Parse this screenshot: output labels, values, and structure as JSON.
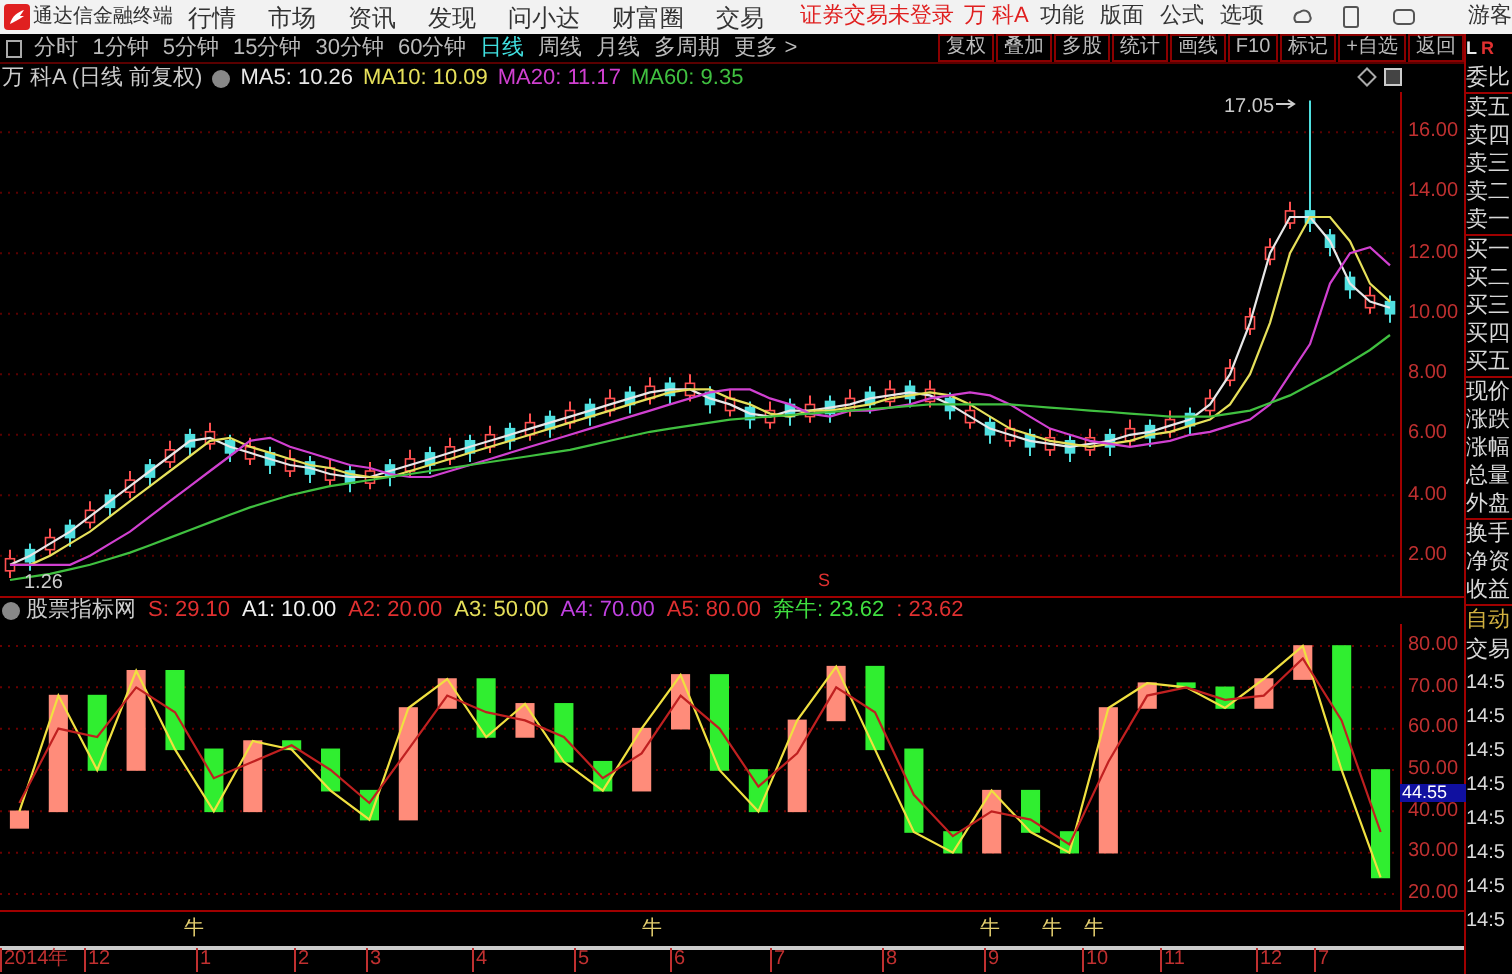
{
  "app_bar": {
    "title": "通达信金融终端",
    "menu": [
      "行情",
      "市场",
      "资讯",
      "发现",
      "问小达",
      "财富圈",
      "交易"
    ],
    "login_status": "证券交易未登录",
    "stock": "万 科A",
    "right_menu": [
      "功能",
      "版面",
      "公式",
      "选项"
    ],
    "user": "游客"
  },
  "period_tabs": [
    {
      "label": "分时",
      "selected": false
    },
    {
      "label": "1分钟",
      "selected": false
    },
    {
      "label": "5分钟",
      "selected": false
    },
    {
      "label": "15分钟",
      "selected": false
    },
    {
      "label": "30分钟",
      "selected": false
    },
    {
      "label": "60分钟",
      "selected": false
    },
    {
      "label": "日线",
      "selected": true
    },
    {
      "label": "周线",
      "selected": false
    },
    {
      "label": "月线",
      "selected": false
    },
    {
      "label": "多周期",
      "selected": false
    },
    {
      "label": "更多 >",
      "selected": false
    }
  ],
  "toolbar_buttons": [
    "复权",
    "叠加",
    "多股",
    "统计",
    "画线",
    "F10",
    "标记",
    "+自选",
    "返回"
  ],
  "main_chart": {
    "title": "万 科A (日线 前复权)",
    "ma": [
      {
        "label": "MA5: 10.26",
        "color": "#e8e8e8"
      },
      {
        "label": "MA10: 10.09",
        "color": "#e6e05a"
      },
      {
        "label": "MA20: 11.17",
        "color": "#d040d0"
      },
      {
        "label": "MA60: 9.35",
        "color": "#40c040"
      }
    ],
    "high_label": "17.05",
    "low_label": "1.26",
    "signal_mark": "S",
    "chart_data": {
      "type": "candlestick",
      "grid": true,
      "ylim": [
        0.8,
        17.2
      ],
      "yticks": [
        {
          "value": 16,
          "label": "16.00"
        },
        {
          "value": 14,
          "label": "14.00"
        },
        {
          "value": 12,
          "label": "12.00"
        },
        {
          "value": 10,
          "label": "10.00"
        },
        {
          "value": 8,
          "label": "8.00"
        },
        {
          "value": 6,
          "label": "6.00"
        },
        {
          "value": 4,
          "label": "4.00"
        },
        {
          "value": 2,
          "label": "2.00"
        }
      ],
      "ohlc": [
        [
          1.5,
          2.2,
          1.26,
          1.9
        ],
        [
          2.2,
          2.4,
          1.5,
          1.8
        ],
        [
          2.2,
          2.9,
          2.0,
          2.6
        ],
        [
          3.0,
          3.2,
          2.3,
          2.6
        ],
        [
          3.1,
          3.8,
          2.9,
          3.5
        ],
        [
          4.0,
          4.2,
          3.3,
          3.6
        ],
        [
          4.1,
          4.8,
          3.9,
          4.5
        ],
        [
          5.0,
          5.2,
          4.3,
          4.6
        ],
        [
          5.1,
          5.8,
          4.9,
          5.5
        ],
        [
          6.0,
          6.2,
          5.3,
          5.6
        ],
        [
          5.7,
          6.4,
          5.5,
          6.1
        ],
        [
          5.8,
          6.0,
          5.1,
          5.4
        ],
        [
          5.2,
          5.9,
          5.0,
          5.6
        ],
        [
          5.4,
          5.6,
          4.7,
          5.0
        ],
        [
          4.8,
          5.5,
          4.6,
          5.2
        ],
        [
          5.1,
          5.3,
          4.4,
          4.7
        ],
        [
          4.5,
          5.2,
          4.3,
          4.9
        ],
        [
          4.8,
          5.0,
          4.1,
          4.4
        ],
        [
          4.4,
          5.1,
          4.2,
          4.8
        ],
        [
          5.0,
          5.2,
          4.3,
          4.6
        ],
        [
          4.8,
          5.5,
          4.6,
          5.2
        ],
        [
          5.4,
          5.6,
          4.7,
          5.0
        ],
        [
          5.2,
          5.9,
          5.0,
          5.6
        ],
        [
          5.8,
          6.0,
          5.1,
          5.4
        ],
        [
          5.6,
          6.3,
          5.4,
          6.0
        ],
        [
          6.2,
          6.4,
          5.5,
          5.8
        ],
        [
          6.0,
          6.7,
          5.8,
          6.4
        ],
        [
          6.6,
          6.8,
          5.9,
          6.2
        ],
        [
          6.4,
          7.1,
          6.2,
          6.8
        ],
        [
          7.0,
          7.2,
          6.3,
          6.6
        ],
        [
          6.8,
          7.5,
          6.6,
          7.2
        ],
        [
          7.4,
          7.6,
          6.7,
          7.0
        ],
        [
          7.2,
          7.9,
          7.0,
          7.6
        ],
        [
          7.7,
          7.9,
          7.0,
          7.3
        ],
        [
          7.3,
          8.0,
          7.1,
          7.7
        ],
        [
          7.4,
          7.6,
          6.7,
          7.0
        ],
        [
          6.8,
          7.5,
          6.6,
          7.2
        ],
        [
          6.9,
          7.1,
          6.2,
          6.5
        ],
        [
          6.4,
          7.1,
          6.2,
          6.8
        ],
        [
          7.0,
          7.2,
          6.3,
          6.6
        ],
        [
          6.6,
          7.3,
          6.4,
          7.0
        ],
        [
          7.1,
          7.3,
          6.4,
          6.7
        ],
        [
          6.8,
          7.5,
          6.6,
          7.2
        ],
        [
          7.4,
          7.6,
          6.7,
          7.0
        ],
        [
          7.1,
          7.8,
          6.9,
          7.5
        ],
        [
          7.6,
          7.8,
          6.9,
          7.2
        ],
        [
          7.1,
          7.8,
          6.9,
          7.5
        ],
        [
          7.2,
          7.4,
          6.5,
          6.8
        ],
        [
          6.4,
          7.1,
          6.2,
          6.8
        ],
        [
          6.4,
          6.6,
          5.7,
          6.0
        ],
        [
          5.8,
          6.5,
          5.6,
          6.2
        ],
        [
          6.0,
          6.2,
          5.3,
          5.6
        ],
        [
          5.5,
          6.2,
          5.3,
          5.9
        ],
        [
          5.8,
          6.0,
          5.1,
          5.4
        ],
        [
          5.5,
          6.2,
          5.3,
          5.9
        ],
        [
          6.0,
          6.2,
          5.3,
          5.6
        ],
        [
          5.8,
          6.5,
          5.6,
          6.2
        ],
        [
          6.3,
          6.5,
          5.6,
          5.9
        ],
        [
          6.1,
          6.8,
          5.9,
          6.5
        ],
        [
          6.7,
          6.9,
          6.0,
          6.3
        ],
        [
          6.8,
          7.5,
          6.6,
          7.2
        ],
        [
          7.8,
          8.5,
          7.6,
          8.2
        ],
        [
          9.5,
          10.2,
          9.3,
          9.9
        ],
        [
          11.8,
          12.5,
          11.6,
          12.2
        ],
        [
          13.0,
          13.7,
          12.8,
          13.4
        ],
        [
          13.4,
          17.05,
          12.7,
          13.0
        ],
        [
          12.6,
          12.8,
          11.9,
          12.2
        ],
        [
          11.2,
          11.4,
          10.5,
          10.8
        ],
        [
          10.2,
          10.9,
          10.0,
          10.6
        ],
        [
          10.4,
          10.6,
          9.7,
          10.0
        ]
      ],
      "series": [
        {
          "type": "line",
          "color": "#e8e8e8",
          "values": [
            1.7,
            2.0,
            2.4,
            2.8,
            3.3,
            3.8,
            4.3,
            4.8,
            5.3,
            5.8,
            5.9,
            5.6,
            5.4,
            5.2,
            5.0,
            4.9,
            4.7,
            4.6,
            4.6,
            4.8,
            5.0,
            5.2,
            5.4,
            5.6,
            5.8,
            6.0,
            6.2,
            6.4,
            6.6,
            6.8,
            7.0,
            7.2,
            7.4,
            7.5,
            7.5,
            7.2,
            7.0,
            6.7,
            6.6,
            6.8,
            6.8,
            6.9,
            7.0,
            7.2,
            7.3,
            7.4,
            7.3,
            7.0,
            6.6,
            6.2,
            6.0,
            5.8,
            5.7,
            5.6,
            5.7,
            5.8,
            6.0,
            6.1,
            6.3,
            6.5,
            7.0,
            8.0,
            9.7,
            12.0,
            13.2,
            13.2,
            12.4,
            11.0,
            10.4,
            10.2
          ]
        },
        {
          "type": "line",
          "color": "#e6e05a",
          "values": [
            1.7,
            1.7,
            2.0,
            2.4,
            2.8,
            3.3,
            3.8,
            4.3,
            4.8,
            5.3,
            5.8,
            5.9,
            5.6,
            5.4,
            5.2,
            5.0,
            4.9,
            4.7,
            4.6,
            4.6,
            4.8,
            5.0,
            5.2,
            5.4,
            5.6,
            5.8,
            6.0,
            6.2,
            6.4,
            6.6,
            6.8,
            7.0,
            7.2,
            7.4,
            7.5,
            7.5,
            7.2,
            7.0,
            6.7,
            6.6,
            6.8,
            6.8,
            6.9,
            7.0,
            7.2,
            7.3,
            7.4,
            7.3,
            7.0,
            6.6,
            6.2,
            6.0,
            5.8,
            5.7,
            5.6,
            5.7,
            5.8,
            6.0,
            6.1,
            6.3,
            6.5,
            7.0,
            8.0,
            9.7,
            12.0,
            13.2,
            13.2,
            12.4,
            11.0,
            10.4
          ]
        },
        {
          "type": "line",
          "color": "#d040d0",
          "values": [
            1.7,
            1.7,
            1.7,
            1.7,
            2.0,
            2.4,
            2.8,
            3.3,
            3.8,
            4.3,
            4.8,
            5.3,
            5.8,
            5.9,
            5.6,
            5.4,
            5.2,
            5.0,
            4.9,
            4.7,
            4.6,
            4.6,
            4.8,
            5.0,
            5.2,
            5.4,
            5.6,
            5.8,
            6.0,
            6.2,
            6.4,
            6.6,
            6.8,
            7.0,
            7.2,
            7.4,
            7.5,
            7.5,
            7.2,
            7.0,
            6.7,
            6.6,
            6.8,
            6.8,
            6.9,
            7.0,
            7.2,
            7.3,
            7.4,
            7.3,
            7.0,
            6.6,
            6.2,
            6.0,
            5.8,
            5.7,
            5.6,
            5.7,
            5.8,
            6.0,
            6.1,
            6.3,
            6.5,
            7.0,
            8.0,
            9.0,
            11.0,
            12.0,
            12.2,
            11.6
          ]
        },
        {
          "type": "line",
          "color": "#40c040",
          "values": [
            1.2,
            1.3,
            1.4,
            1.55,
            1.7,
            1.9,
            2.1,
            2.35,
            2.6,
            2.85,
            3.1,
            3.35,
            3.6,
            3.8,
            4.0,
            4.15,
            4.3,
            4.4,
            4.5,
            4.6,
            4.7,
            4.8,
            4.9,
            5.0,
            5.1,
            5.2,
            5.3,
            5.4,
            5.5,
            5.65,
            5.8,
            5.95,
            6.1,
            6.2,
            6.3,
            6.4,
            6.5,
            6.55,
            6.6,
            6.65,
            6.7,
            6.75,
            6.8,
            6.85,
            6.9,
            6.95,
            7.0,
            7.0,
            7.0,
            7.0,
            7.0,
            6.95,
            6.9,
            6.85,
            6.8,
            6.75,
            6.7,
            6.65,
            6.6,
            6.6,
            6.6,
            6.7,
            6.8,
            7.05,
            7.3,
            7.65,
            8.0,
            8.4,
            8.8,
            9.3
          ]
        }
      ]
    }
  },
  "indicator": {
    "name": "股票指标网",
    "values": [
      {
        "label": "S: 29.10",
        "color": "#e03030"
      },
      {
        "label": "A1: 10.00",
        "color": "#f0f0f0"
      },
      {
        "label": "A2: 20.00",
        "color": "#e03030"
      },
      {
        "label": "A3: 50.00",
        "color": "#e6e05a"
      },
      {
        "label": "A4: 70.00",
        "color": "#c040e0"
      },
      {
        "label": "A5: 80.00",
        "color": "#e03030"
      },
      {
        "label": "奔牛: 23.62",
        "color": "#40e040"
      },
      {
        "label": ": 23.62",
        "color": "#e03030"
      }
    ],
    "current_value": "44.55",
    "signals": [
      "牛",
      "牛",
      "牛",
      "牛",
      "牛"
    ],
    "chart_data": {
      "type": "candlestick",
      "grid": true,
      "ylim": [
        20,
        80
      ],
      "ohlc": [
        [
          36,
          40,
          36,
          40
        ],
        [
          40,
          68,
          40,
          68
        ],
        [
          68,
          68,
          50,
          50
        ],
        [
          50,
          74,
          50,
          74
        ],
        [
          74,
          74,
          55,
          55
        ],
        [
          55,
          55,
          40,
          40
        ],
        [
          40,
          57,
          40,
          57
        ],
        [
          57,
          57,
          55,
          55
        ],
        [
          55,
          55,
          45,
          45
        ],
        [
          45,
          45,
          38,
          38
        ],
        [
          38,
          65,
          38,
          65
        ],
        [
          65,
          72,
          65,
          72
        ],
        [
          72,
          72,
          58,
          58
        ],
        [
          58,
          66,
          58,
          66
        ],
        [
          66,
          66,
          52,
          52
        ],
        [
          52,
          52,
          45,
          45
        ],
        [
          45,
          60,
          45,
          60
        ],
        [
          60,
          73,
          60,
          73
        ],
        [
          73,
          73,
          50,
          50
        ],
        [
          50,
          50,
          40,
          40
        ],
        [
          40,
          62,
          40,
          62
        ],
        [
          62,
          75,
          62,
          75
        ],
        [
          75,
          75,
          55,
          55
        ],
        [
          55,
          55,
          35,
          35
        ],
        [
          35,
          35,
          30,
          30
        ],
        [
          30,
          45,
          30,
          45
        ],
        [
          45,
          45,
          35,
          35
        ],
        [
          35,
          35,
          30,
          30
        ],
        [
          30,
          65,
          30,
          65
        ],
        [
          65,
          71,
          65,
          71
        ],
        [
          71,
          71,
          70,
          70
        ],
        [
          70,
          70,
          65,
          65
        ],
        [
          65,
          72,
          65,
          72
        ],
        [
          72,
          80,
          72,
          80
        ],
        [
          80,
          80,
          50,
          50
        ],
        [
          50,
          50,
          24,
          24
        ]
      ],
      "yticks": [
        {
          "value": 80,
          "label": "80.00"
        },
        {
          "value": 70,
          "label": "70.00"
        },
        {
          "value": 60,
          "label": "60.00"
        },
        {
          "value": 50,
          "label": "50.00"
        },
        {
          "value": 40,
          "label": "40.00"
        },
        {
          "value": 30,
          "label": "30.00"
        },
        {
          "value": 20,
          "label": "20.00"
        }
      ],
      "series": [
        {
          "type": "line",
          "color": "#f0e040",
          "values": [
            40,
            68,
            50,
            74,
            55,
            40,
            57,
            55,
            45,
            38,
            65,
            72,
            58,
            66,
            52,
            45,
            60,
            73,
            50,
            40,
            62,
            75,
            55,
            35,
            30,
            45,
            35,
            30,
            65,
            71,
            70,
            65,
            72,
            80,
            50,
            24
          ]
        },
        {
          "type": "line",
          "color": "#c02020",
          "values": [
            42,
            60,
            58,
            70,
            64,
            48,
            52,
            56,
            50,
            42,
            55,
            68,
            64,
            62,
            58,
            48,
            54,
            68,
            60,
            46,
            54,
            70,
            64,
            44,
            34,
            40,
            38,
            32,
            52,
            68,
            70,
            67,
            68,
            77,
            62,
            35
          ]
        }
      ]
    }
  },
  "x_axis": [
    "2014年",
    "12",
    "1",
    "2",
    "3",
    "4",
    "5",
    "6",
    "7",
    "8",
    "9",
    "10",
    "11",
    "12",
    "7"
  ],
  "quote_panel": {
    "header": [
      "L",
      "R"
    ],
    "groups": [
      [
        "委比"
      ],
      [
        "卖五",
        "卖四",
        "卖三",
        "卖二",
        "卖一"
      ],
      [
        "买一",
        "买二",
        "买三",
        "买四",
        "买五"
      ],
      [
        "现价",
        "涨跌",
        "涨幅",
        "总量",
        "外盘"
      ],
      [
        "换手",
        "净资",
        "收益"
      ]
    ],
    "mode": "自动",
    "trade": "交易",
    "times": [
      "14:5",
      "14:5",
      "14:5",
      "14:5",
      "14:5",
      "14:5",
      "14:5",
      "14:5"
    ]
  }
}
